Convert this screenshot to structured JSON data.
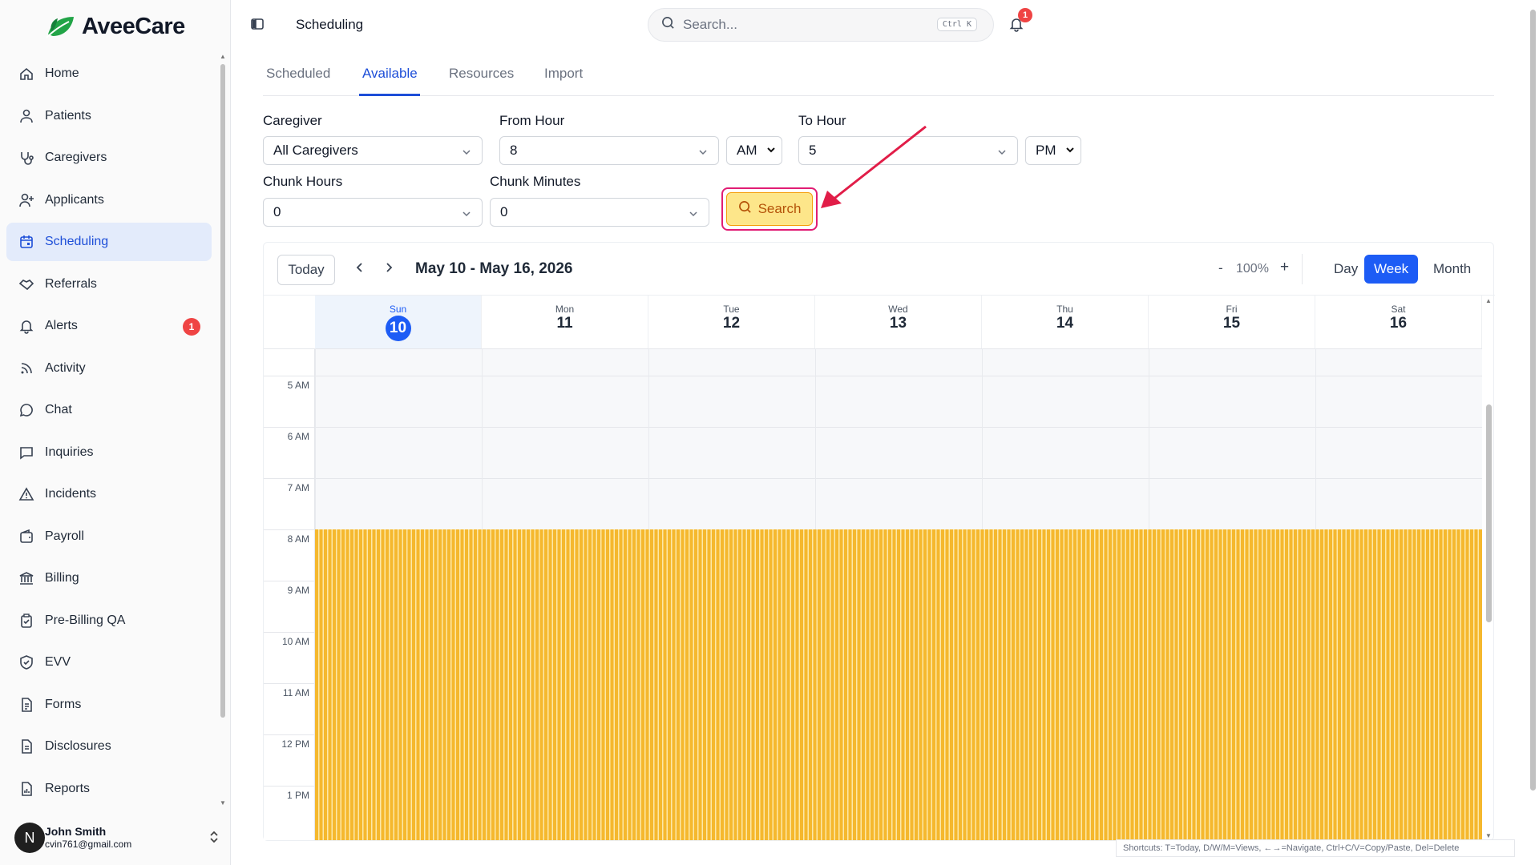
{
  "app": {
    "name": "AveeCare",
    "brand_color": "#1d5cf5",
    "accent_color": "#f5b82e"
  },
  "sidebar": {
    "items": [
      {
        "label": "Home",
        "icon": "home-icon"
      },
      {
        "label": "Patients",
        "icon": "user-icon"
      },
      {
        "label": "Caregivers",
        "icon": "stethoscope-icon"
      },
      {
        "label": "Applicants",
        "icon": "user-plus-icon"
      },
      {
        "label": "Scheduling",
        "icon": "calendar-icon",
        "active": true
      },
      {
        "label": "Referrals",
        "icon": "handshake-icon"
      },
      {
        "label": "Alerts",
        "icon": "bell-icon",
        "badge": "1"
      },
      {
        "label": "Activity",
        "icon": "rss-icon"
      },
      {
        "label": "Chat",
        "icon": "chat-bubble-icon"
      },
      {
        "label": "Inquiries",
        "icon": "message-square-icon"
      },
      {
        "label": "Incidents",
        "icon": "warning-triangle-icon"
      },
      {
        "label": "Payroll",
        "icon": "wallet-icon"
      },
      {
        "label": "Billing",
        "icon": "bank-icon"
      },
      {
        "label": "Pre-Billing QA",
        "icon": "clipboard-check-icon"
      },
      {
        "label": "EVV",
        "icon": "shield-check-icon"
      },
      {
        "label": "Forms",
        "icon": "file-text-icon"
      },
      {
        "label": "Disclosures",
        "icon": "file-icon"
      },
      {
        "label": "Reports",
        "icon": "file-chart-icon"
      }
    ],
    "user": {
      "initial": "N",
      "name": "John Smith",
      "email": "cvin761@gmail.com"
    }
  },
  "header": {
    "title": "Scheduling",
    "search_placeholder": "Search...",
    "search_shortcut": "Ctrl K",
    "notification_count": "1"
  },
  "tabs": [
    "Scheduled",
    "Available",
    "Resources",
    "Import"
  ],
  "active_tab": "Available",
  "filters": {
    "caregiver_label": "Caregiver",
    "caregiver_value": "All Caregivers",
    "from_hour_label": "From Hour",
    "from_hour_value": "8",
    "from_ampm": "AM",
    "to_hour_label": "To Hour",
    "to_hour_value": "5",
    "to_ampm": "PM",
    "chunk_hours_label": "Chunk Hours",
    "chunk_hours_value": "0",
    "chunk_minutes_label": "Chunk Minutes",
    "chunk_minutes_value": "0",
    "search_button": "Search"
  },
  "calendar": {
    "today_button": "Today",
    "prev": "‹",
    "next": "›",
    "range": "May 10 - May 16, 2026",
    "zoom_minus": "-",
    "zoom": "100%",
    "zoom_plus": "+",
    "views": [
      "Day",
      "Week",
      "Month"
    ],
    "active_view": "Week",
    "days": [
      {
        "name": "Sun",
        "num": "10",
        "today": true
      },
      {
        "name": "Mon",
        "num": "11"
      },
      {
        "name": "Tue",
        "num": "12"
      },
      {
        "name": "Wed",
        "num": "13"
      },
      {
        "name": "Thu",
        "num": "14"
      },
      {
        "name": "Fri",
        "num": "15"
      },
      {
        "name": "Sat",
        "num": "16"
      }
    ],
    "hours": [
      "5 AM",
      "6 AM",
      "7 AM",
      "8 AM",
      "9 AM",
      "10 AM",
      "11 AM",
      "12 PM",
      "1 PM"
    ],
    "availability_start": "8 AM"
  },
  "shortcuts": "Shortcuts: T=Today, D/W/M=Views, ←→=Navigate, Ctrl+C/V=Copy/Paste, Del=Delete"
}
